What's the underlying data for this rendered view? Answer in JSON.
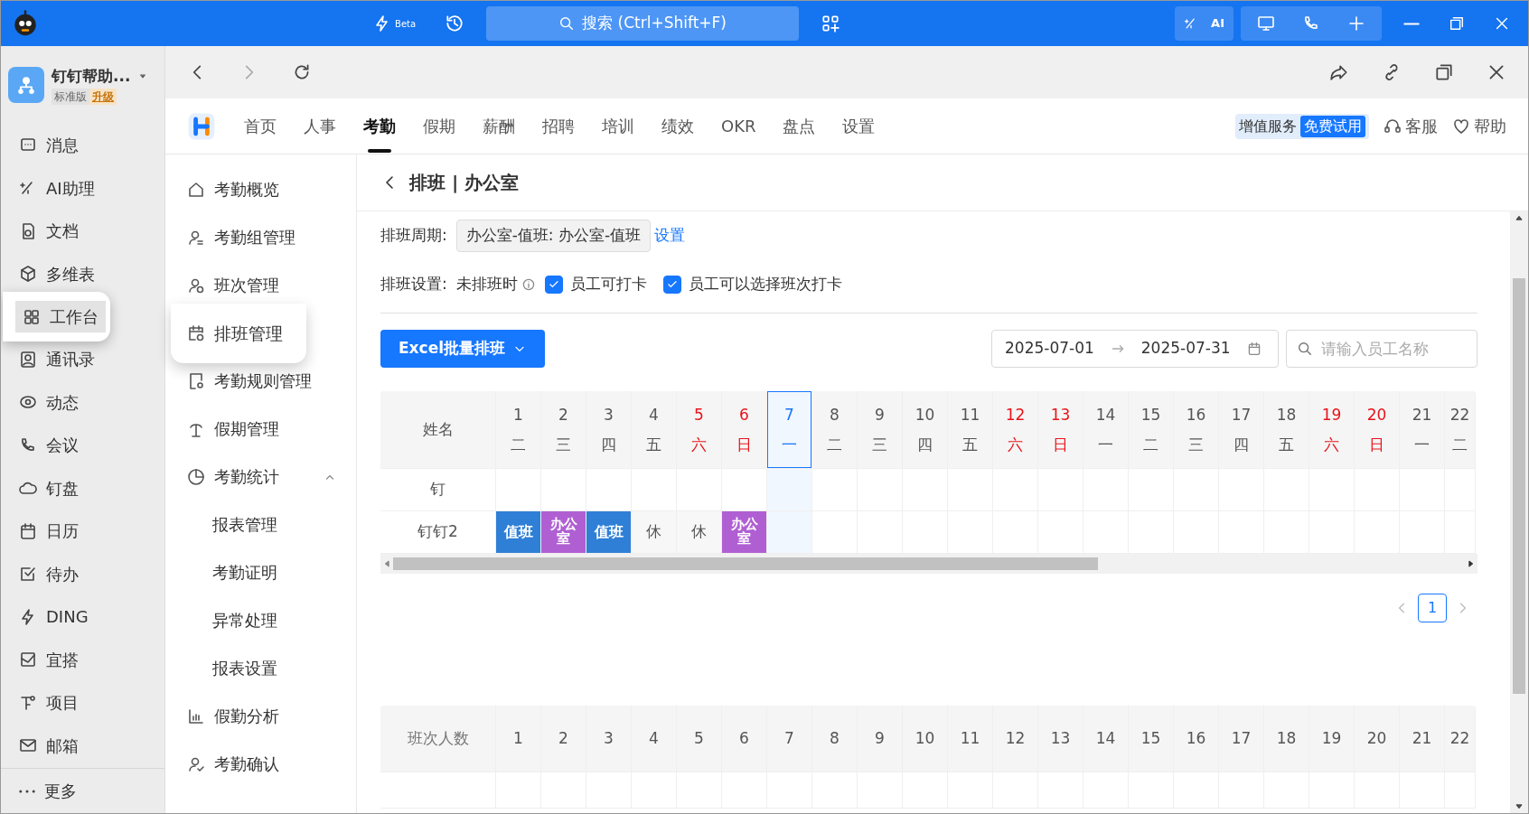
{
  "titlebar": {
    "search_placeholder": "搜索 (Ctrl+Shift+F)",
    "beta_label": "Beta",
    "ai_label": "AI"
  },
  "profile": {
    "name": "钉钉帮助...",
    "edition": "标准版",
    "upgrade": "升级"
  },
  "rail": [
    {
      "label": "消息",
      "selected": false
    },
    {
      "label": "AI助理",
      "selected": false
    },
    {
      "label": "文档",
      "selected": false
    },
    {
      "label": "多维表",
      "selected": false
    },
    {
      "label": "工作台",
      "selected": true
    },
    {
      "label": "通讯录",
      "selected": false
    },
    {
      "label": "动态",
      "selected": false
    },
    {
      "label": "会议",
      "selected": false
    },
    {
      "label": "钉盘",
      "selected": false
    },
    {
      "label": "日历",
      "selected": false
    },
    {
      "label": "待办",
      "selected": false
    },
    {
      "label": "DING",
      "selected": false
    },
    {
      "label": "宜搭",
      "selected": false
    },
    {
      "label": "项目",
      "selected": false
    },
    {
      "label": "邮箱",
      "selected": false
    }
  ],
  "rail_more": "更多",
  "app_tabs": [
    {
      "label": "首页",
      "selected": false
    },
    {
      "label": "人事",
      "selected": false
    },
    {
      "label": "考勤",
      "selected": true
    },
    {
      "label": "假期",
      "selected": false
    },
    {
      "label": "薪酬",
      "selected": false
    },
    {
      "label": "招聘",
      "selected": false
    },
    {
      "label": "培训",
      "selected": false
    },
    {
      "label": "绩效",
      "selected": false
    },
    {
      "label": "OKR",
      "selected": false
    },
    {
      "label": "盘点",
      "selected": false
    },
    {
      "label": "设置",
      "selected": false
    }
  ],
  "header_right": {
    "value_service": "增值服务",
    "trial": "免费试用",
    "support": "客服",
    "help": "帮助"
  },
  "menu": [
    {
      "label": "考勤概览",
      "selected": false
    },
    {
      "label": "考勤组管理",
      "selected": false
    },
    {
      "label": "班次管理",
      "selected": false
    },
    {
      "label": "排班管理",
      "selected": true
    },
    {
      "label": "考勤规则管理",
      "selected": false
    },
    {
      "label": "假期管理",
      "selected": false
    },
    {
      "label": "考勤统计",
      "selected": false,
      "expanded": true,
      "children": [
        {
          "label": "报表管理",
          "selected": false
        },
        {
          "label": "考勤证明",
          "selected": false
        },
        {
          "label": "异常处理",
          "selected": false
        },
        {
          "label": "报表设置",
          "selected": false
        }
      ]
    },
    {
      "label": "假勤分析",
      "selected": false
    },
    {
      "label": "考勤确认",
      "selected": false
    }
  ],
  "page": {
    "title": "排班 | 办公室",
    "cycle_label": "排班周期:",
    "cycle_value": "办公室-值班: 办公室-值班",
    "cycle_link": "设置",
    "settings_label": "排班设置:",
    "unscheduled_label": "未排班时",
    "options": [
      {
        "label": "员工可打卡",
        "checked": true
      },
      {
        "label": "员工可以选择班次打卡",
        "checked": true
      }
    ],
    "batch_button": "Excel批量排班",
    "date_start": "2025-07-01",
    "date_end": "2025-07-31",
    "search_placeholder": "请输入员工名称"
  },
  "schedule": {
    "name_header": "姓名",
    "days": [
      {
        "date": "1",
        "weekday": "二",
        "weekend": false,
        "selected": false
      },
      {
        "date": "2",
        "weekday": "三",
        "weekend": false,
        "selected": false
      },
      {
        "date": "3",
        "weekday": "四",
        "weekend": false,
        "selected": false
      },
      {
        "date": "4",
        "weekday": "五",
        "weekend": false,
        "selected": false
      },
      {
        "date": "5",
        "weekday": "六",
        "weekend": true,
        "selected": false
      },
      {
        "date": "6",
        "weekday": "日",
        "weekend": true,
        "selected": false
      },
      {
        "date": "7",
        "weekday": "一",
        "weekend": false,
        "selected": true
      },
      {
        "date": "8",
        "weekday": "二",
        "weekend": false,
        "selected": false
      },
      {
        "date": "9",
        "weekday": "三",
        "weekend": false,
        "selected": false
      },
      {
        "date": "10",
        "weekday": "四",
        "weekend": false,
        "selected": false
      },
      {
        "date": "11",
        "weekday": "五",
        "weekend": false,
        "selected": false
      },
      {
        "date": "12",
        "weekday": "六",
        "weekend": true,
        "selected": false
      },
      {
        "date": "13",
        "weekday": "日",
        "weekend": true,
        "selected": false
      },
      {
        "date": "14",
        "weekday": "一",
        "weekend": false,
        "selected": false
      },
      {
        "date": "15",
        "weekday": "二",
        "weekend": false,
        "selected": false
      },
      {
        "date": "16",
        "weekday": "三",
        "weekend": false,
        "selected": false
      },
      {
        "date": "17",
        "weekday": "四",
        "weekend": false,
        "selected": false
      },
      {
        "date": "18",
        "weekday": "五",
        "weekend": false,
        "selected": false
      },
      {
        "date": "19",
        "weekday": "六",
        "weekend": true,
        "selected": false
      },
      {
        "date": "20",
        "weekday": "日",
        "weekend": true,
        "selected": false
      },
      {
        "date": "21",
        "weekday": "一",
        "weekend": false,
        "selected": false
      },
      {
        "date": "22",
        "weekday": "二",
        "weekend": false,
        "selected": false
      }
    ],
    "rows": [
      {
        "name": "钉",
        "shifts": []
      },
      {
        "name": "钉钉2",
        "shifts": [
          {
            "label": "值班",
            "kind": "shift",
            "color": "#2f7fd6"
          },
          {
            "label": "办公室",
            "kind": "shift",
            "color": "#b05fd3"
          },
          {
            "label": "值班",
            "kind": "shift",
            "color": "#2f7fd6"
          },
          {
            "label": "休",
            "kind": "rest"
          },
          {
            "label": "休",
            "kind": "rest"
          },
          {
            "label": "办公室",
            "kind": "shift",
            "color": "#b05fd3"
          }
        ]
      }
    ]
  },
  "pagination": [
    {
      "label": "1",
      "selected": true
    }
  ],
  "counts": {
    "header": "班次人数",
    "days": [
      "1",
      "2",
      "3",
      "4",
      "5",
      "6",
      "7",
      "8",
      "9",
      "10",
      "11",
      "12",
      "13",
      "14",
      "15",
      "16",
      "17",
      "18",
      "19",
      "20",
      "21",
      "22"
    ]
  }
}
